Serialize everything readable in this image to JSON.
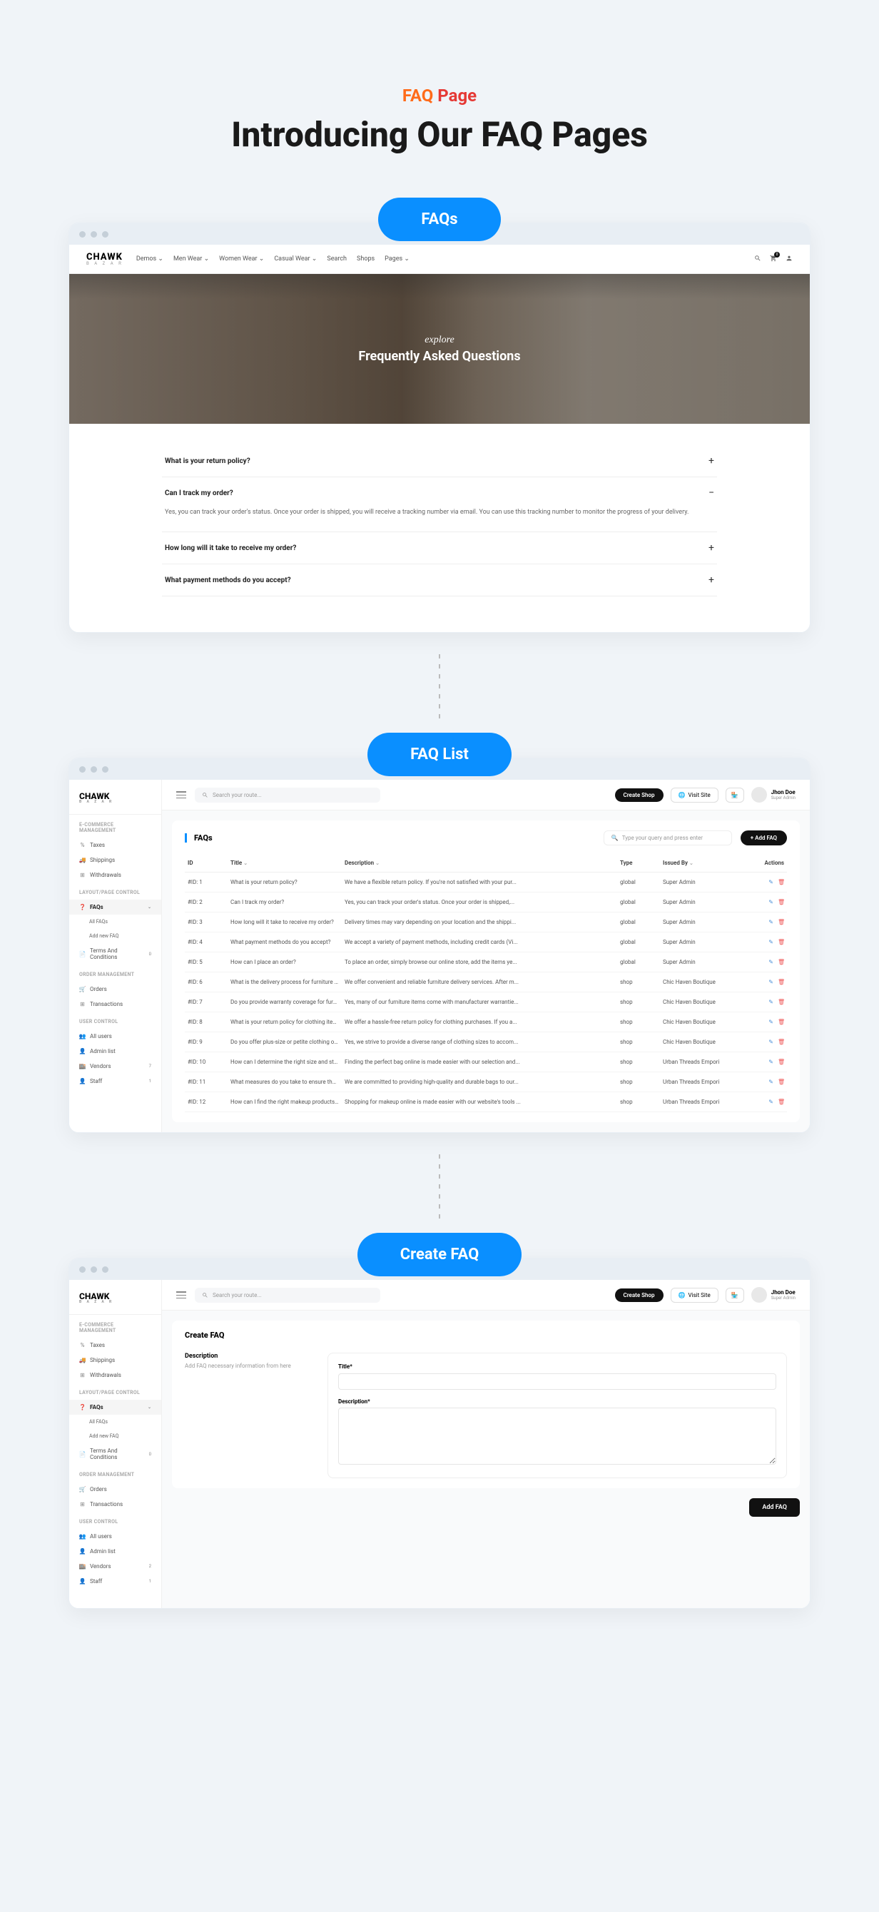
{
  "header": {
    "label_part1": "FAQ",
    "label_part2": "Page",
    "title": "Introducing Our FAQ Pages"
  },
  "pills": {
    "faqs": "FAQs",
    "faq_list": "FAQ List",
    "create_faq": "Create FAQ"
  },
  "storefront": {
    "logo": "CHAWK",
    "logo_sub": "B A Z A R",
    "nav": [
      "Demos ⌄",
      "Men Wear ⌄",
      "Women Wear ⌄",
      "Casual Wear ⌄",
      "Search",
      "Shops",
      "Pages ⌄"
    ],
    "hero_script": "explore",
    "hero_title": "Frequently Asked Questions",
    "faqs": [
      {
        "q": "What is your return policy?",
        "open": false,
        "a": ""
      },
      {
        "q": "Can I track my order?",
        "open": true,
        "a": "Yes, you can track your order's status. Once your order is shipped, you will receive a tracking number via email. You can use this tracking number to monitor the progress of your delivery."
      },
      {
        "q": "How long will it take to receive my order?",
        "open": false,
        "a": ""
      },
      {
        "q": "What payment methods do you accept?",
        "open": false,
        "a": ""
      }
    ]
  },
  "admin": {
    "logo": "CHAWK",
    "logo_sub": "B A Z A R",
    "search_placeholder": "Search your route...",
    "create_shop": "Create Shop",
    "visit_site": "Visit Site",
    "user_name": "Jhon Doe",
    "user_role": "Super Admin",
    "sections": {
      "ecommerce": "E-COMMERCE MANAGEMENT",
      "layout": "LAYOUT/PAGE CONTROL",
      "order": "ORDER MANAGEMENT",
      "user": "USER CONTROL"
    },
    "items": {
      "taxes": "Taxes",
      "shippings": "Shippings",
      "withdrawals": "Withdrawals",
      "faqs": "FAQs",
      "all_faqs": "All FAQs",
      "add_new_faq": "Add new FAQ",
      "terms": "Terms And Conditions",
      "terms_badge": "0",
      "orders": "Orders",
      "transactions": "Transactions",
      "all_users": "All users",
      "admin_list": "Admin list",
      "vendors": "Vendors",
      "vendors_badge": "7",
      "staff": "Staff",
      "staff_badge": "1",
      "vendors_badge2": "2"
    }
  },
  "faq_list_panel": {
    "title": "FAQs",
    "search_placeholder": "Type your query and press enter",
    "add_btn": "+ Add FAQ",
    "columns": {
      "id": "ID",
      "title": "Title",
      "desc": "Description",
      "type": "Type",
      "by": "Issued By",
      "actions": "Actions"
    },
    "rows": [
      {
        "id": "#ID: 1",
        "title": "What is your return policy?",
        "desc": "We have a flexible return policy. If you're not satisfied with your pur...",
        "type": "global",
        "by": "Super Admin"
      },
      {
        "id": "#ID: 2",
        "title": "Can I track my order?",
        "desc": "Yes, you can track your order's status. Once your order is shipped,...",
        "type": "global",
        "by": "Super Admin"
      },
      {
        "id": "#ID: 3",
        "title": "How long will it take to receive my order?",
        "desc": "Delivery times may vary depending on your location and the shippi...",
        "type": "global",
        "by": "Super Admin"
      },
      {
        "id": "#ID: 4",
        "title": "What payment methods do you accept?",
        "desc": "We accept a variety of payment methods, including credit cards (Vi...",
        "type": "global",
        "by": "Super Admin"
      },
      {
        "id": "#ID: 5",
        "title": "How can I place an order?",
        "desc": "To place an order, simply browse our online store, add the items ye...",
        "type": "global",
        "by": "Super Admin"
      },
      {
        "id": "#ID: 6",
        "title": "What is the delivery process for furniture p...",
        "desc": "We offer convenient and reliable furniture delivery services. After m...",
        "type": "shop",
        "by": "Chic Haven Boutique"
      },
      {
        "id": "#ID: 7",
        "title": "Do you provide warranty coverage for furni...",
        "desc": "Yes, many of our furniture items come with manufacturer warrantie...",
        "type": "shop",
        "by": "Chic Haven Boutique"
      },
      {
        "id": "#ID: 8",
        "title": "What is your return policy for clothing items?",
        "desc": "We offer a hassle-free return policy for clothing purchases. If you a...",
        "type": "shop",
        "by": "Chic Haven Boutique"
      },
      {
        "id": "#ID: 9",
        "title": "Do you offer plus-size or petite clothing op...",
        "desc": "Yes, we strive to provide a diverse range of clothing sizes to accom...",
        "type": "shop",
        "by": "Chic Haven Boutique"
      },
      {
        "id": "#ID: 10",
        "title": "How can I determine the right size and styl...",
        "desc": "Finding the perfect bag online is made easier with our selection and...",
        "type": "shop",
        "by": "Urban Threads Empori"
      },
      {
        "id": "#ID: 11",
        "title": "What measures do you take to ensure the ...",
        "desc": "We are committed to providing high-quality and durable bags to our...",
        "type": "shop",
        "by": "Urban Threads Empori"
      },
      {
        "id": "#ID: 12",
        "title": "How can I find the right makeup products f...",
        "desc": "Shopping for makeup online is made easier with our website's tools ...",
        "type": "shop",
        "by": "Urban Threads Empori"
      }
    ]
  },
  "create_panel": {
    "page_title": "Create FAQ",
    "desc_title": "Description",
    "desc_sub": "Add FAQ necessary information from here",
    "title_label": "Title*",
    "desc_label": "Description*",
    "submit": "Add FAQ"
  }
}
